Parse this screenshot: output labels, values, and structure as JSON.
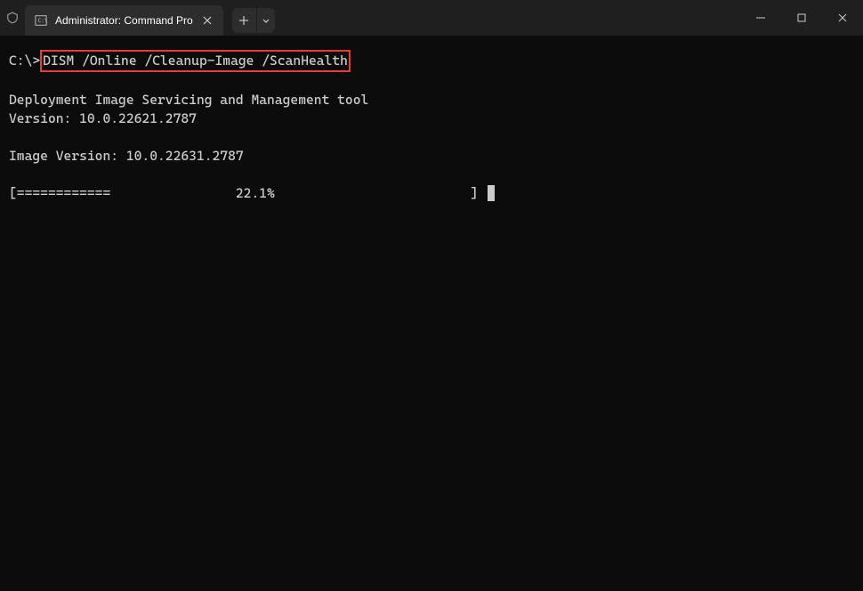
{
  "titlebar": {
    "tab_title": "Administrator: Command Pro"
  },
  "terminal": {
    "prompt": "C:\\>",
    "command": "DISM /Online /Cleanup-Image /ScanHealth",
    "output_line1": "Deployment Image Servicing and Management tool",
    "output_line2": "Version: 10.0.22621.2787",
    "output_line3": "Image Version: 10.0.22631.2787",
    "progress_bar": "[============                22.1%                         ]"
  }
}
